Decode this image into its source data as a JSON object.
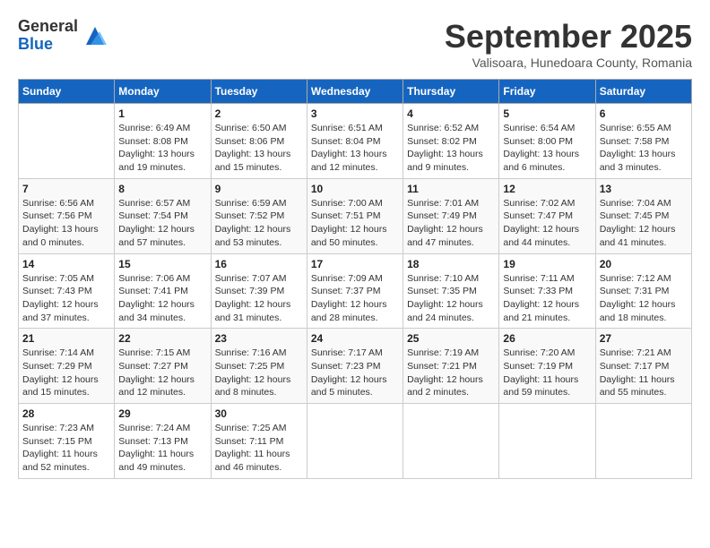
{
  "logo": {
    "general": "General",
    "blue": "Blue"
  },
  "title": "September 2025",
  "location": "Valisoara, Hunedoara County, Romania",
  "weekdays": [
    "Sunday",
    "Monday",
    "Tuesday",
    "Wednesday",
    "Thursday",
    "Friday",
    "Saturday"
  ],
  "weeks": [
    [
      {
        "day": "",
        "detail": ""
      },
      {
        "day": "1",
        "detail": "Sunrise: 6:49 AM\nSunset: 8:08 PM\nDaylight: 13 hours\nand 19 minutes."
      },
      {
        "day": "2",
        "detail": "Sunrise: 6:50 AM\nSunset: 8:06 PM\nDaylight: 13 hours\nand 15 minutes."
      },
      {
        "day": "3",
        "detail": "Sunrise: 6:51 AM\nSunset: 8:04 PM\nDaylight: 13 hours\nand 12 minutes."
      },
      {
        "day": "4",
        "detail": "Sunrise: 6:52 AM\nSunset: 8:02 PM\nDaylight: 13 hours\nand 9 minutes."
      },
      {
        "day": "5",
        "detail": "Sunrise: 6:54 AM\nSunset: 8:00 PM\nDaylight: 13 hours\nand 6 minutes."
      },
      {
        "day": "6",
        "detail": "Sunrise: 6:55 AM\nSunset: 7:58 PM\nDaylight: 13 hours\nand 3 minutes."
      }
    ],
    [
      {
        "day": "7",
        "detail": "Sunrise: 6:56 AM\nSunset: 7:56 PM\nDaylight: 13 hours\nand 0 minutes."
      },
      {
        "day": "8",
        "detail": "Sunrise: 6:57 AM\nSunset: 7:54 PM\nDaylight: 12 hours\nand 57 minutes."
      },
      {
        "day": "9",
        "detail": "Sunrise: 6:59 AM\nSunset: 7:52 PM\nDaylight: 12 hours\nand 53 minutes."
      },
      {
        "day": "10",
        "detail": "Sunrise: 7:00 AM\nSunset: 7:51 PM\nDaylight: 12 hours\nand 50 minutes."
      },
      {
        "day": "11",
        "detail": "Sunrise: 7:01 AM\nSunset: 7:49 PM\nDaylight: 12 hours\nand 47 minutes."
      },
      {
        "day": "12",
        "detail": "Sunrise: 7:02 AM\nSunset: 7:47 PM\nDaylight: 12 hours\nand 44 minutes."
      },
      {
        "day": "13",
        "detail": "Sunrise: 7:04 AM\nSunset: 7:45 PM\nDaylight: 12 hours\nand 41 minutes."
      }
    ],
    [
      {
        "day": "14",
        "detail": "Sunrise: 7:05 AM\nSunset: 7:43 PM\nDaylight: 12 hours\nand 37 minutes."
      },
      {
        "day": "15",
        "detail": "Sunrise: 7:06 AM\nSunset: 7:41 PM\nDaylight: 12 hours\nand 34 minutes."
      },
      {
        "day": "16",
        "detail": "Sunrise: 7:07 AM\nSunset: 7:39 PM\nDaylight: 12 hours\nand 31 minutes."
      },
      {
        "day": "17",
        "detail": "Sunrise: 7:09 AM\nSunset: 7:37 PM\nDaylight: 12 hours\nand 28 minutes."
      },
      {
        "day": "18",
        "detail": "Sunrise: 7:10 AM\nSunset: 7:35 PM\nDaylight: 12 hours\nand 24 minutes."
      },
      {
        "day": "19",
        "detail": "Sunrise: 7:11 AM\nSunset: 7:33 PM\nDaylight: 12 hours\nand 21 minutes."
      },
      {
        "day": "20",
        "detail": "Sunrise: 7:12 AM\nSunset: 7:31 PM\nDaylight: 12 hours\nand 18 minutes."
      }
    ],
    [
      {
        "day": "21",
        "detail": "Sunrise: 7:14 AM\nSunset: 7:29 PM\nDaylight: 12 hours\nand 15 minutes."
      },
      {
        "day": "22",
        "detail": "Sunrise: 7:15 AM\nSunset: 7:27 PM\nDaylight: 12 hours\nand 12 minutes."
      },
      {
        "day": "23",
        "detail": "Sunrise: 7:16 AM\nSunset: 7:25 PM\nDaylight: 12 hours\nand 8 minutes."
      },
      {
        "day": "24",
        "detail": "Sunrise: 7:17 AM\nSunset: 7:23 PM\nDaylight: 12 hours\nand 5 minutes."
      },
      {
        "day": "25",
        "detail": "Sunrise: 7:19 AM\nSunset: 7:21 PM\nDaylight: 12 hours\nand 2 minutes."
      },
      {
        "day": "26",
        "detail": "Sunrise: 7:20 AM\nSunset: 7:19 PM\nDaylight: 11 hours\nand 59 minutes."
      },
      {
        "day": "27",
        "detail": "Sunrise: 7:21 AM\nSunset: 7:17 PM\nDaylight: 11 hours\nand 55 minutes."
      }
    ],
    [
      {
        "day": "28",
        "detail": "Sunrise: 7:23 AM\nSunset: 7:15 PM\nDaylight: 11 hours\nand 52 minutes."
      },
      {
        "day": "29",
        "detail": "Sunrise: 7:24 AM\nSunset: 7:13 PM\nDaylight: 11 hours\nand 49 minutes."
      },
      {
        "day": "30",
        "detail": "Sunrise: 7:25 AM\nSunset: 7:11 PM\nDaylight: 11 hours\nand 46 minutes."
      },
      {
        "day": "",
        "detail": ""
      },
      {
        "day": "",
        "detail": ""
      },
      {
        "day": "",
        "detail": ""
      },
      {
        "day": "",
        "detail": ""
      }
    ]
  ]
}
